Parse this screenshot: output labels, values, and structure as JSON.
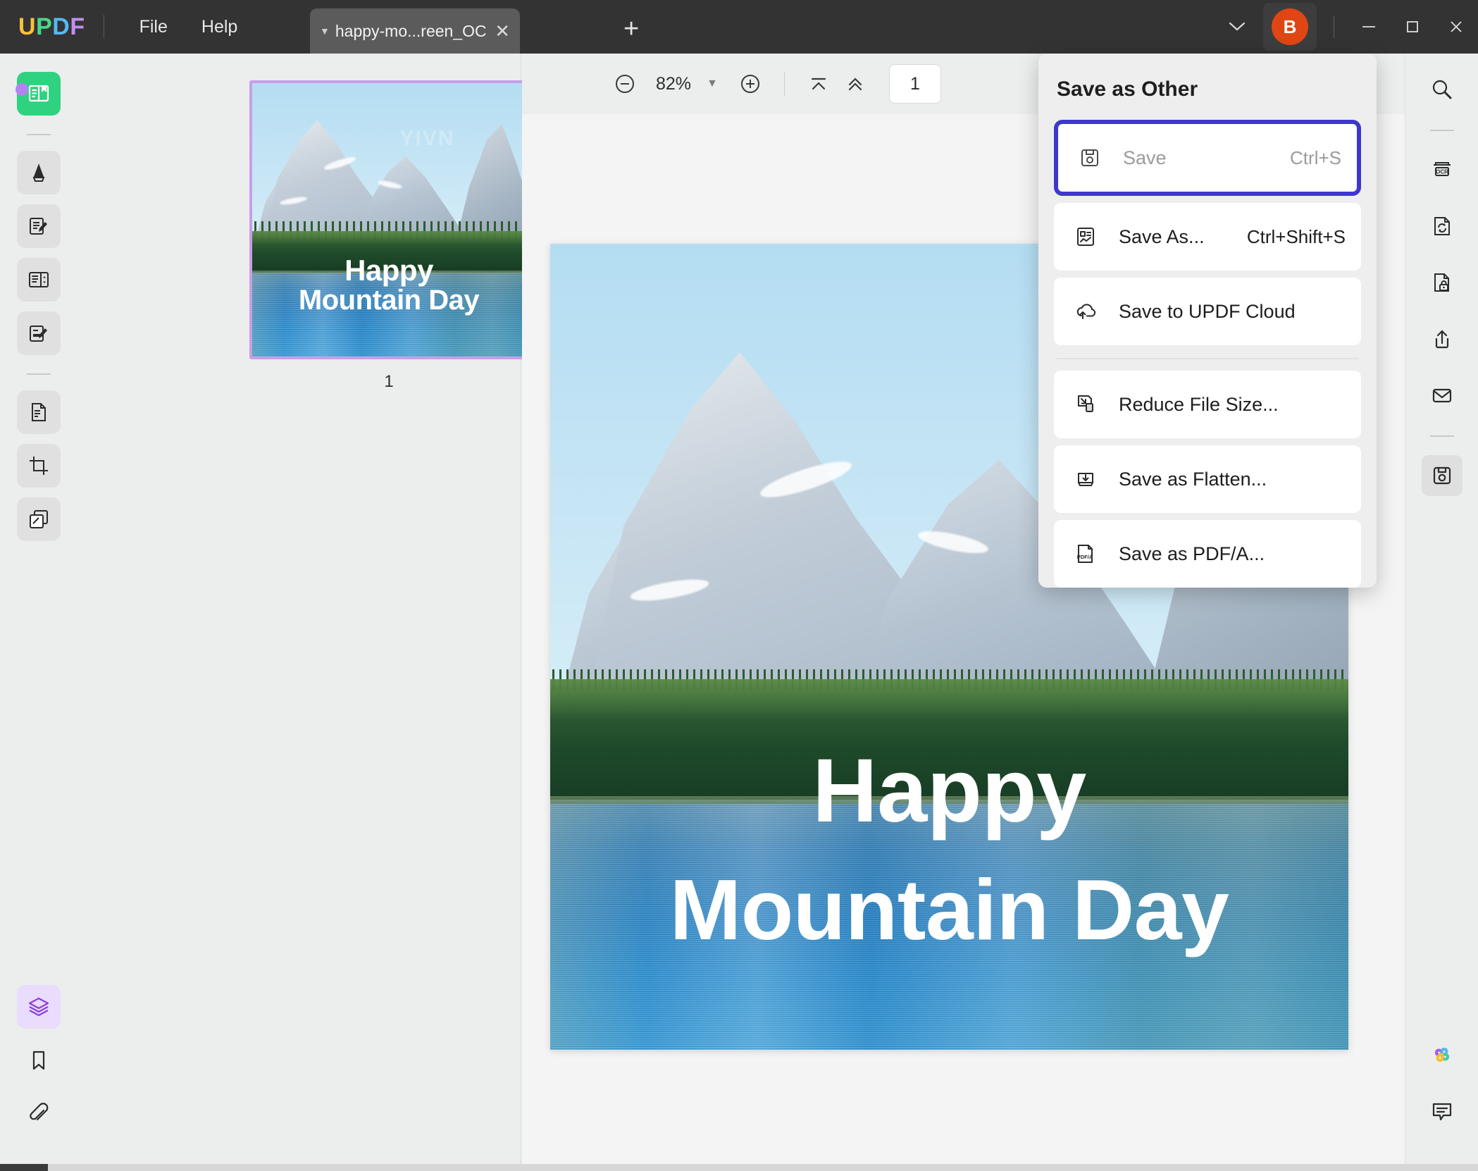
{
  "app": {
    "logo_letters": [
      "U",
      "P",
      "D",
      "F"
    ],
    "menus": [
      {
        "label": "File",
        "name": "file"
      },
      {
        "label": "Help",
        "name": "help"
      }
    ],
    "tab": {
      "title": "happy-mo...reen_OCR",
      "caret_icon": "chevron-down-icon",
      "close_icon": "close-icon"
    },
    "new_tab_icon": "plus-icon",
    "window": {
      "chevron_icon": "chevron-down-icon",
      "avatar_initial": "B",
      "avatar_color": "#df4614",
      "minimize_icon": "minimize-icon",
      "maximize_icon": "maximize-icon",
      "close_icon": "close-icon"
    }
  },
  "left_rail": {
    "items": [
      {
        "name": "reader-tool",
        "icon": "book-reader-icon",
        "state": "active-green"
      },
      {
        "name": "comment-tool",
        "icon": "highlighter-icon",
        "state": "bg"
      },
      {
        "name": "edit-pdf-tool",
        "icon": "edit-document-icon",
        "state": "bg"
      },
      {
        "name": "page-edit-tool",
        "icon": "organize-pages-icon",
        "state": "bg"
      },
      {
        "name": "annotate-tool",
        "icon": "annotate-icon",
        "state": "bg"
      },
      {
        "name": "convert-pdf-tool",
        "icon": "convert-file-icon",
        "state": "bg"
      },
      {
        "name": "crop-tool",
        "icon": "crop-icon",
        "state": "bg"
      },
      {
        "name": "batch-tool",
        "icon": "batch-pages-icon",
        "state": "bg"
      }
    ],
    "bottom_items": [
      {
        "name": "layers-panel",
        "icon": "layers-icon",
        "state": "active-purple"
      },
      {
        "name": "bookmarks-panel",
        "icon": "bookmark-icon",
        "state": "plain"
      },
      {
        "name": "attachments-panel",
        "icon": "paperclip-icon",
        "state": "plain"
      }
    ]
  },
  "toolbar": {
    "zoom_out_icon": "minus-circle-icon",
    "zoom_value": "82%",
    "zoom_caret_icon": "caret-down-icon",
    "zoom_in_icon": "plus-circle-icon",
    "first_page_icon": "first-page-icon",
    "prev_page_icon": "previous-page-icon",
    "page_number": "1"
  },
  "thumbnails": {
    "pages": [
      {
        "number": "1",
        "selected": true
      }
    ]
  },
  "document": {
    "heading_line1": "Happy",
    "heading_line2": "Mountain Day",
    "watermark": "YIVN"
  },
  "right_rail": {
    "items": [
      {
        "name": "search-tool",
        "icon": "search-icon",
        "state": "plain"
      },
      {
        "name": "ocr-tool",
        "icon": "ocr-icon",
        "state": "plain"
      },
      {
        "name": "convert-tool",
        "icon": "convert-doc-icon",
        "state": "plain"
      },
      {
        "name": "protect-tool",
        "icon": "lock-document-icon",
        "state": "plain"
      },
      {
        "name": "share-tool",
        "icon": "share-icon",
        "state": "plain"
      },
      {
        "name": "email-tool",
        "icon": "mail-icon",
        "state": "plain"
      },
      {
        "name": "save-tool",
        "icon": "floppy-save-icon",
        "state": "active"
      }
    ],
    "bottom_items": [
      {
        "name": "ai-assistant",
        "icon": "ai-clover-icon",
        "state": "plain"
      },
      {
        "name": "comments-panel",
        "icon": "comment-bubble-icon",
        "state": "plain"
      }
    ]
  },
  "save_menu": {
    "title": "Save as Other",
    "highlight_color": "#3d37cf",
    "groups": [
      {
        "items": [
          {
            "name": "save",
            "icon": "floppy-save-icon",
            "label": "Save",
            "shortcut": "Ctrl+S",
            "disabled": true,
            "highlighted": true
          },
          {
            "name": "save-as",
            "icon": "save-as-icon",
            "label": "Save As...",
            "shortcut": "Ctrl+Shift+S",
            "disabled": false,
            "highlighted": false
          },
          {
            "name": "save-to-cloud",
            "icon": "cloud-upload-icon",
            "label": "Save to UPDF Cloud",
            "shortcut": "",
            "disabled": false,
            "highlighted": false
          }
        ]
      },
      {
        "items": [
          {
            "name": "reduce-file-size",
            "icon": "compress-icon",
            "label": "Reduce File Size...",
            "shortcut": "",
            "disabled": false,
            "highlighted": false
          },
          {
            "name": "save-as-flatten",
            "icon": "flatten-icon",
            "label": "Save as Flatten...",
            "shortcut": "",
            "disabled": false,
            "highlighted": false
          },
          {
            "name": "save-as-pdfa",
            "icon": "pdfa-icon",
            "label": "Save as PDF/A...",
            "shortcut": "",
            "disabled": false,
            "highlighted": false
          }
        ]
      }
    ]
  }
}
